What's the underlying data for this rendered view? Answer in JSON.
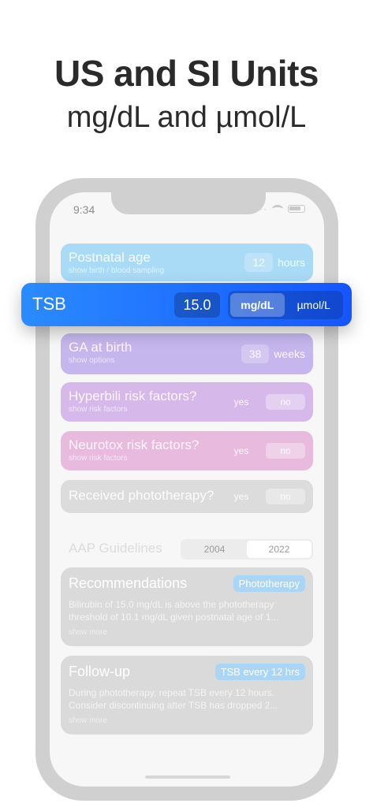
{
  "headline": "US and SI Units",
  "subheadline": "mg/dL and µmol/L",
  "status_bar": {
    "time": "9:34"
  },
  "tsb": {
    "label": "TSB",
    "value": "15.0",
    "units": [
      "mg/dL",
      "µmol/L"
    ],
    "selected_unit": "mg/dL"
  },
  "postnatal_age": {
    "title": "Postnatal age",
    "subtitle": "show birth / blood sampling",
    "value": "12",
    "unit": "hours"
  },
  "ga_at_birth": {
    "title": "GA at birth",
    "subtitle": "show options",
    "value": "38",
    "unit": "weeks"
  },
  "hyperbili": {
    "title": "Hyperbili risk factors?",
    "subtitle": "show risk factors",
    "yes": "yes",
    "no": "no"
  },
  "neurotox": {
    "title": "Neurotox risk factors?",
    "subtitle": "show risk factors",
    "yes": "yes",
    "no": "no"
  },
  "phototherapy": {
    "title": "Received phototherapy?",
    "yes": "yes",
    "no": "no"
  },
  "aap": {
    "label": "AAP Guidelines",
    "options": [
      "2004",
      "2022"
    ],
    "selected": "2022"
  },
  "recommendations": {
    "title": "Recommendations",
    "tag": "Phototherapy",
    "body": "Bilirubin of 15.0 mg/dL is above the phototherapy threshold of 10.1 mg/dL given postnatal age of 1...",
    "more": "show more"
  },
  "followup": {
    "title": "Follow-up",
    "tag": "TSB every 12 hrs",
    "body": "During phototherapy, repeat TSB every 12 hours. Consider discontinuing after TSB has dropped 2...",
    "more": "show more"
  },
  "colors": {
    "tsb_bar": "#1a6bff",
    "age_card": "#a9daf6",
    "ga_card": "#c5b6ed",
    "hyper_card": "#d6b8ea",
    "neuro_card": "#e7bade"
  }
}
